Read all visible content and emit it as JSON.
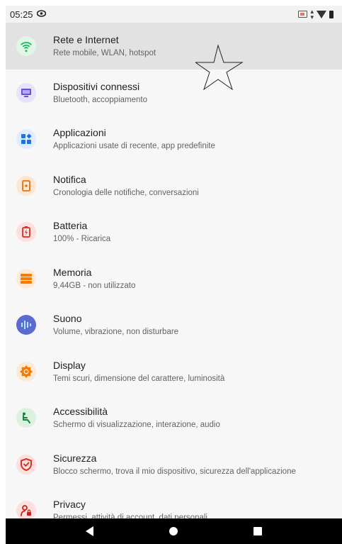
{
  "statusbar": {
    "time": "05:25",
    "icons": [
      "eye-icon",
      "cast-icon",
      "data-arrows-icon",
      "wifi-icon",
      "battery-icon"
    ]
  },
  "settings": {
    "items": [
      {
        "title": "Rete e Internet",
        "subtitle": "Rete mobile, WLAN, hotspot",
        "icon": "wifi-icon",
        "color": "#3ddc84",
        "bg": "#e1f8e9"
      },
      {
        "title": "Dispositivi connessi",
        "subtitle": "Bluetooth, accoppiamento",
        "icon": "devices-icon",
        "color": "#7b61ff",
        "bg": "#e9e4ff"
      },
      {
        "title": "Applicazioni",
        "subtitle": "Applicazioni usate di recente, app predefinite",
        "icon": "apps-icon",
        "color": "#1a73e8",
        "bg": "#e3efff"
      },
      {
        "title": "Notifica",
        "subtitle": "Cronologia delle notifiche, conversazioni",
        "icon": "notification-icon",
        "color": "#f28b30",
        "bg": "#fde9d7"
      },
      {
        "title": "Batteria",
        "subtitle": "100% - Ricarica",
        "icon": "battery-icon",
        "color": "#e8453c",
        "bg": "#fde3e1"
      },
      {
        "title": "Memoria",
        "subtitle": "9,44GB - non utilizzato",
        "icon": "storage-icon",
        "color": "#f57c00",
        "bg": "#feeedd"
      },
      {
        "title": "Suono",
        "subtitle": "Volume, vibrazione, non disturbare",
        "icon": "sound-icon",
        "color": "#5c6bc0",
        "bg": "#5c6bc0"
      },
      {
        "title": "Display",
        "subtitle": "Temi scuri, dimensione del carattere, luminosità",
        "icon": "display-icon",
        "color": "#f57c00",
        "bg": "#feeedd"
      },
      {
        "title": "Accessibilità",
        "subtitle": "Schermo di visualizzazione, interazione, audio",
        "icon": "accessibility-icon",
        "color": "#2e7d32",
        "bg": "#dff3e2"
      },
      {
        "title": "Sicurezza",
        "subtitle": "Blocco schermo, trova il mio dispositivo, sicurezza dell'applicazione",
        "icon": "security-icon",
        "color": "#e8453c",
        "bg": "#fde3e1"
      },
      {
        "title": "Privacy",
        "subtitle": "Permessi, attività di account, dati personali",
        "icon": "privacy-icon",
        "color": "#c62828",
        "bg": "#fde3e1"
      }
    ]
  },
  "navbar": {
    "buttons": [
      "back-icon",
      "home-icon",
      "recents-icon"
    ]
  }
}
